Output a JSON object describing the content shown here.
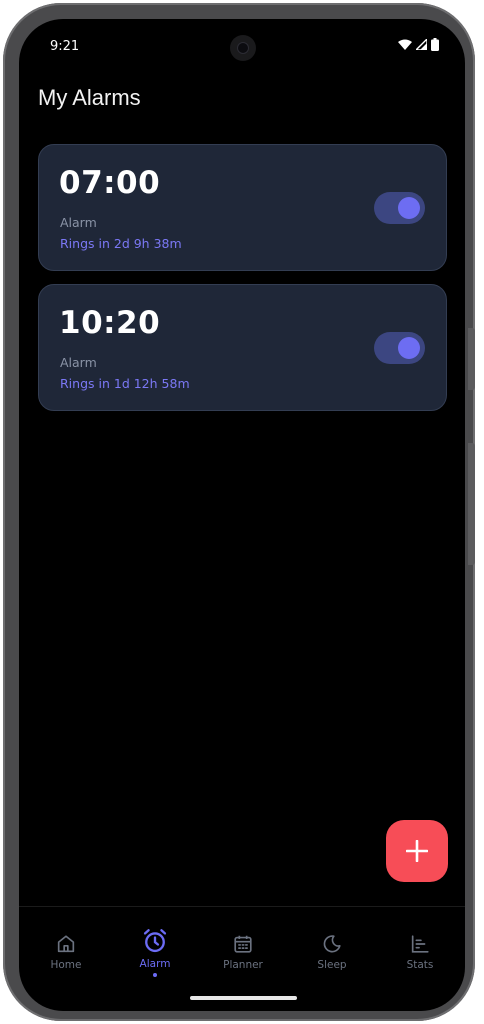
{
  "status_bar": {
    "time": "9:21"
  },
  "page": {
    "title": "My Alarms"
  },
  "alarms": [
    {
      "time": "07:00",
      "label": "Alarm",
      "rings": "Rings in 2d 9h 38m",
      "enabled": true
    },
    {
      "time": "10:20",
      "label": "Alarm",
      "rings": "Rings in 1d 12h 58m",
      "enabled": true
    }
  ],
  "fab": {
    "icon": "plus-icon"
  },
  "nav": {
    "items": [
      {
        "label": "Home",
        "icon": "home-icon",
        "active": false
      },
      {
        "label": "Alarm",
        "icon": "alarm-clock-icon",
        "active": true
      },
      {
        "label": "Planner",
        "icon": "calendar-icon",
        "active": false
      },
      {
        "label": "Sleep",
        "icon": "moon-icon",
        "active": false
      },
      {
        "label": "Stats",
        "icon": "bar-chart-icon",
        "active": false
      }
    ]
  },
  "colors": {
    "background": "#000000",
    "card": "#1f2738",
    "accent": "#6d6df2",
    "fab": "#f74d57",
    "muted": "#8a93a6"
  }
}
